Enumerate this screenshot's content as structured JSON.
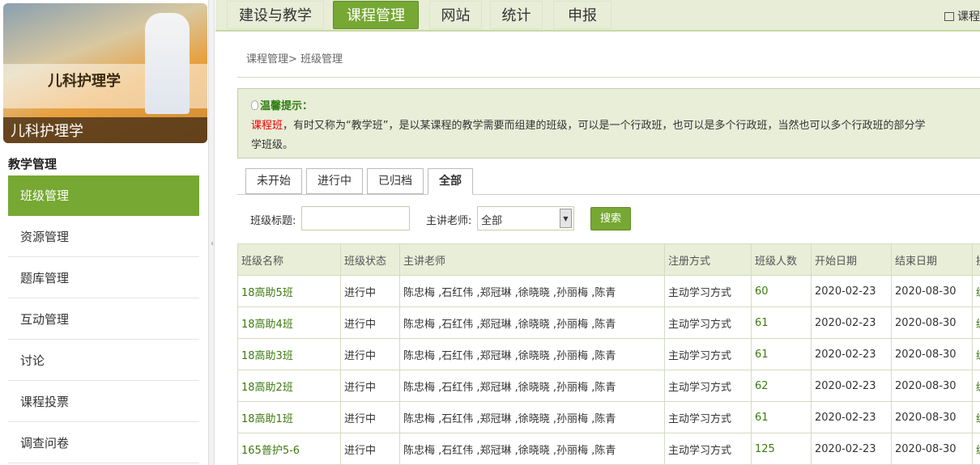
{
  "sidebar": {
    "course_title": "儿科护理学",
    "cover_title": "儿科护理学",
    "section": "教学管理",
    "items": [
      {
        "label": "班级管理"
      },
      {
        "label": "资源管理"
      },
      {
        "label": "题库管理"
      },
      {
        "label": "互动管理"
      },
      {
        "label": "讨论"
      },
      {
        "label": "课程投票"
      },
      {
        "label": "调查问卷"
      }
    ]
  },
  "nav": {
    "items": [
      {
        "label": "建设与教学"
      },
      {
        "label": "课程管理"
      },
      {
        "label": "网站"
      },
      {
        "label": "统计"
      },
      {
        "label": "申报"
      }
    ],
    "right_link": "课程"
  },
  "breadcrumb": "课程管理> 班级管理",
  "tip": {
    "head": "温馨提示：",
    "term": "课程班",
    "text": "，有时又称为“教学班”，是以某课程的教学需要而组建的班级，可以是一个行政班，也可以是多个行政班，当然也可以多个行政班的部分学",
    "text2": "学班级。"
  },
  "tabs": [
    {
      "label": "未开始"
    },
    {
      "label": "进行中"
    },
    {
      "label": "已归档"
    },
    {
      "label": "全部"
    }
  ],
  "filter": {
    "title_label": "班级标题:",
    "title_value": "",
    "teacher_label": "主讲老师:",
    "teacher_value": "全部",
    "search": "搜索"
  },
  "table": {
    "headers": [
      "班级名称",
      "班级状态",
      "主讲老师",
      "注册方式",
      "班级人数",
      "开始日期",
      "结束日期",
      "操作"
    ],
    "rows": [
      [
        "18高助5班",
        "进行中",
        "陈忠梅 ,石红伟 ,郑冠琳 ,徐晓晓 ,孙丽梅 ,陈青",
        "主动学习方式",
        "60",
        "2020-02-23",
        "2020-08-30",
        "编辑"
      ],
      [
        "18高助4班",
        "进行中",
        "陈忠梅 ,石红伟 ,郑冠琳 ,徐晓晓 ,孙丽梅 ,陈青",
        "主动学习方式",
        "61",
        "2020-02-23",
        "2020-08-30",
        "编辑"
      ],
      [
        "18高助3班",
        "进行中",
        "陈忠梅 ,石红伟 ,郑冠琳 ,徐晓晓 ,孙丽梅 ,陈青",
        "主动学习方式",
        "61",
        "2020-02-23",
        "2020-08-30",
        "编辑"
      ],
      [
        "18高助2班",
        "进行中",
        "陈忠梅 ,石红伟 ,郑冠琳 ,徐晓晓 ,孙丽梅 ,陈青",
        "主动学习方式",
        "62",
        "2020-02-23",
        "2020-08-30",
        "编辑"
      ],
      [
        "18高助1班",
        "进行中",
        "陈忠梅 ,石红伟 ,郑冠琳 ,徐晓晓 ,孙丽梅 ,陈青",
        "主动学习方式",
        "61",
        "2020-02-23",
        "2020-08-30",
        "编辑"
      ],
      [
        "165普护5-6",
        "进行中",
        "陈忠梅 ,石红伟 ,郑冠琳 ,徐晓晓 ,孙丽梅 ,陈青",
        "主动学习方式",
        "125",
        "2020-02-23",
        "2020-08-30",
        "编辑"
      ]
    ]
  }
}
